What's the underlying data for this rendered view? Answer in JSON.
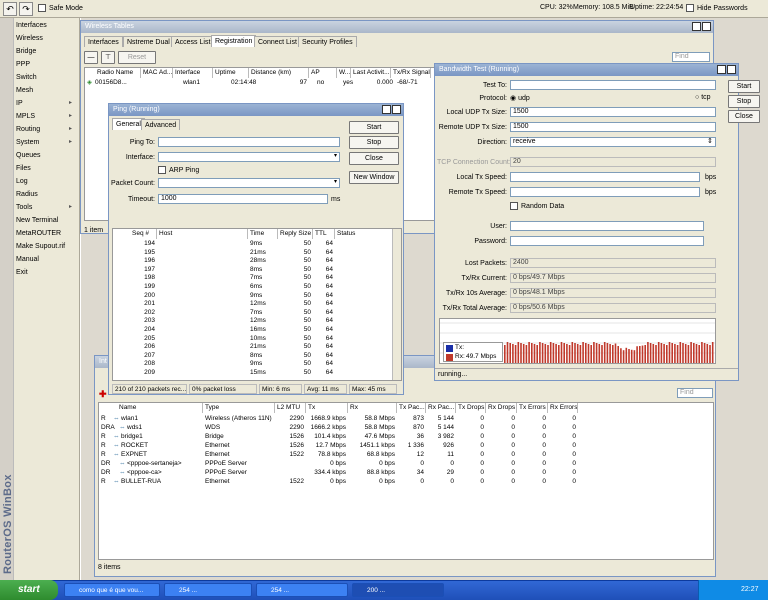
{
  "topbar": {
    "safe_mode": "Safe Mode",
    "cpu": "CPU: 32%",
    "memory": "Memory: 108.5 MiB",
    "uptime": "Uptime: 22:24:54",
    "hide_passwords": "Hide Passwords"
  },
  "sidebar": {
    "brand": "RouterOS WinBox",
    "items": [
      {
        "label": "Interfaces",
        "arrow": ""
      },
      {
        "label": "Wireless",
        "arrow": ""
      },
      {
        "label": "Bridge",
        "arrow": ""
      },
      {
        "label": "PPP",
        "arrow": ""
      },
      {
        "label": "Switch",
        "arrow": ""
      },
      {
        "label": "Mesh",
        "arrow": ""
      },
      {
        "label": "IP",
        "arrow": "▸"
      },
      {
        "label": "MPLS",
        "arrow": "▸"
      },
      {
        "label": "Routing",
        "arrow": "▸"
      },
      {
        "label": "System",
        "arrow": "▸"
      },
      {
        "label": "Queues",
        "arrow": ""
      },
      {
        "label": "Files",
        "arrow": ""
      },
      {
        "label": "Log",
        "arrow": ""
      },
      {
        "label": "Radius",
        "arrow": ""
      },
      {
        "label": "Tools",
        "arrow": "▸"
      },
      {
        "label": "New Terminal",
        "arrow": ""
      },
      {
        "label": "MetaROUTER",
        "arrow": ""
      },
      {
        "label": "Make Supout.rif",
        "arrow": ""
      },
      {
        "label": "Manual",
        "arrow": ""
      },
      {
        "label": "Exit",
        "arrow": ""
      }
    ]
  },
  "wireless": {
    "title": "Wireless Tables",
    "tabs": [
      "Interfaces",
      "Nstreme Dual",
      "Access List",
      "Registration",
      "Connect List",
      "Security Profiles"
    ],
    "active_tab": "Registration",
    "reset": "Reset",
    "find": "Find",
    "columns": [
      "Radio Name",
      "MAC Ad...",
      "Interface",
      "Uptime",
      "Distance (km)",
      "AP",
      "W...",
      "Last Activit...",
      "Tx/Rx Signal"
    ],
    "row": [
      "00156D8...",
      "",
      "wlan1",
      "02:14:48",
      "97",
      "no",
      "yes",
      "0.000",
      "-68/-71"
    ],
    "count": "1 item"
  },
  "ping": {
    "title": "Ping (Running)",
    "tabs": [
      "General",
      "Advanced"
    ],
    "ping_to_label": "Ping To:",
    "interface_label": "Interface:",
    "arp_ping": "ARP Ping",
    "packet_count_label": "Packet Count:",
    "timeout_label": "Timeout:",
    "timeout_value": "1000",
    "timeout_unit": "ms",
    "buttons": [
      "Start",
      "Stop",
      "Close",
      "New Window"
    ],
    "columns": [
      "Seq #",
      "Host",
      "Time",
      "Reply Size",
      "TTL",
      "Status"
    ],
    "rows": [
      [
        "194",
        "",
        "9ms",
        "50",
        "64"
      ],
      [
        "195",
        "",
        "21ms",
        "50",
        "64"
      ],
      [
        "196",
        "",
        "28ms",
        "50",
        "64"
      ],
      [
        "197",
        "",
        "8ms",
        "50",
        "64"
      ],
      [
        "198",
        "",
        "7ms",
        "50",
        "64"
      ],
      [
        "199",
        "",
        "6ms",
        "50",
        "64"
      ],
      [
        "200",
        "",
        "9ms",
        "50",
        "64"
      ],
      [
        "201",
        "",
        "12ms",
        "50",
        "64"
      ],
      [
        "202",
        "",
        "7ms",
        "50",
        "64"
      ],
      [
        "203",
        "",
        "12ms",
        "50",
        "64"
      ],
      [
        "204",
        "",
        "16ms",
        "50",
        "64"
      ],
      [
        "205",
        "",
        "10ms",
        "50",
        "64"
      ],
      [
        "206",
        "",
        "21ms",
        "50",
        "64"
      ],
      [
        "207",
        "",
        "8ms",
        "50",
        "64"
      ],
      [
        "208",
        "",
        "9ms",
        "50",
        "64"
      ],
      [
        "209",
        "",
        "15ms",
        "50",
        "64"
      ]
    ],
    "status": [
      "210 of 210 packets rec...",
      "0% packet loss",
      "Min: 6 ms",
      "Avg: 11 ms",
      "Max: 45 ms"
    ]
  },
  "bandwidth": {
    "title": "Bandwidth Test (Running)",
    "test_to": "Test To:",
    "protocol": "Protocol:",
    "udp": "udp",
    "tcp": "tcp",
    "local_udp": "Local UDP Tx Size:",
    "local_udp_val": "1500",
    "remote_udp": "Remote UDP Tx Size:",
    "remote_udp_val": "1500",
    "direction": "Direction:",
    "direction_val": "receive",
    "tcp_conn": "TCP Connection Count:",
    "tcp_conn_val": "20",
    "local_speed": "Local Tx Speed:",
    "remote_speed": "Remote Tx Speed:",
    "bps": "bps",
    "random_data": "Random Data",
    "user": "User:",
    "password": "Password:",
    "lost": "Lost Packets:",
    "lost_val": "2400",
    "cur": "Tx/Rx Current:",
    "cur_val": "0 bps/49.7 Mbps",
    "avg10": "Tx/Rx 10s Average:",
    "avg10_val": "0 bps/48.1 Mbps",
    "total": "Tx/Rx Total Average:",
    "total_val": "0 bps/50.6 Mbps",
    "legend_tx": "Tx:",
    "legend_rx": "Rx:",
    "legend_rx_val": "49.7 Mbps",
    "status": "running...",
    "buttons": [
      "Start",
      "Stop",
      "Close"
    ],
    "tx_color": "#1a2fa8",
    "rx_color": "#c0392b"
  },
  "interfaces": {
    "title": "Int",
    "find": "Find",
    "count": "8 items",
    "columns": [
      "Name",
      "Type",
      "L2 MTU",
      "Tx",
      "Rx",
      "Tx Pac...",
      "Rx Pac...",
      "Tx Drops",
      "Rx Drops",
      "Tx Errors",
      "Rx Errors"
    ],
    "rows": [
      [
        "R",
        "wlan1",
        "Wireless (Atheros 11N)",
        "2290",
        "1668.9 kbps",
        "58.8 Mbps",
        "873",
        "5 144",
        "0",
        "0",
        "0",
        "0"
      ],
      [
        "DRA",
        "wds1",
        "WDS",
        "2290",
        "1666.2 kbps",
        "58.8 Mbps",
        "870",
        "5 144",
        "0",
        "0",
        "0",
        "0"
      ],
      [
        "R",
        "bridge1",
        "Bridge",
        "1526",
        "101.4 kbps",
        "47.6 Mbps",
        "36",
        "3 982",
        "0",
        "0",
        "0",
        "0"
      ],
      [
        "R",
        "ROCKET",
        "Ethernet",
        "1526",
        "12.7 Mbps",
        "1451.1 kbps",
        "1 336",
        "926",
        "0",
        "0",
        "0",
        "0"
      ],
      [
        "R",
        "EXPNET",
        "Ethernet",
        "1522",
        "78.8 kbps",
        "68.8 kbps",
        "12",
        "11",
        "0",
        "0",
        "0",
        "0"
      ],
      [
        "DR",
        "<pppoe-sertaneja>",
        "PPPoE Server",
        "",
        "0 bps",
        "0 bps",
        "0",
        "0",
        "0",
        "0",
        "0",
        "0"
      ],
      [
        "DR",
        "<pppoe-ca>",
        "PPPoE Server",
        "",
        "334.4 kbps",
        "88.8 kbps",
        "34",
        "29",
        "0",
        "0",
        "0",
        "0"
      ],
      [
        "R",
        "BULLET-RUA",
        "Ethernet",
        "1522",
        "0 bps",
        "0 bps",
        "0",
        "0",
        "0",
        "0",
        "0",
        "0"
      ]
    ]
  },
  "taskbar": {
    "start": "start",
    "tasks": [
      "como que é que vou...",
      "254 ...",
      "254 ...",
      "200 ..."
    ],
    "clock": "22:27"
  }
}
